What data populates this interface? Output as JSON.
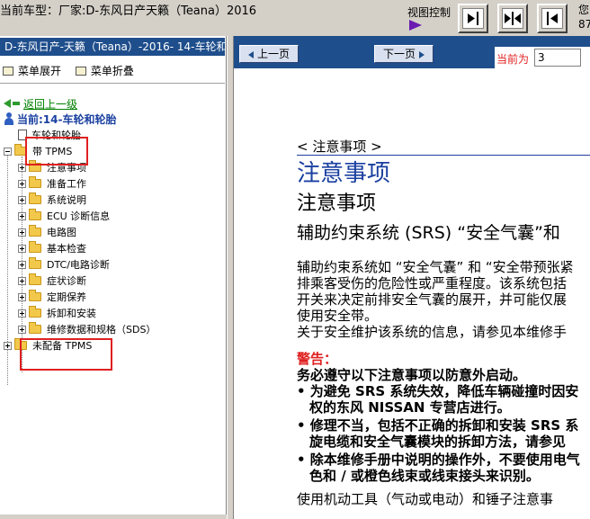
{
  "topbar": {
    "title": "当前车型：厂家:D-东风日产天籁（Teana）2016",
    "view_control_label": "视图控制",
    "right_text": "您 87"
  },
  "left": {
    "header": "D-东风日产-天籁（Teana）-2016- 14-车轮和轮胎",
    "expand_all": "菜单展开",
    "collapse_all": "菜单折叠",
    "back": "返回上一级",
    "current": "当前:14-车轮和轮胎",
    "doc": "车轮和轮胎",
    "with_tpms": "带 TPMS",
    "children": [
      "注意事项",
      "准备工作",
      "系统说明",
      "ECU 诊断信息",
      "电路图",
      "基本检查",
      "DTC/电路诊断",
      "症状诊断",
      "定期保养",
      "拆卸和安装",
      "维修数据和规格（SDS）"
    ],
    "without_tpms": "未配备 TPMS"
  },
  "right": {
    "prev": "上一页",
    "next": "下一页",
    "page_label": "当前为",
    "page_value": "3",
    "crumb": "< 注意事项 >",
    "h1": "注意事项",
    "h2": "注意事项",
    "h3": "辅助约束系统 (SRS) “安全气囊”和",
    "para1": "辅助约束系统如 “安全气囊” 和 “安全带预张紧",
    "para2": "排乘客受伤的危险性或严重程度。该系统包括",
    "para3": "开关来决定前排安全气囊的展开，并可能仅展",
    "para4": "使用安全带。",
    "para5": "关于安全维护该系统的信息，请参见本维修手",
    "warn": "警告：",
    "warn_line": "务必遵守以下注意事项以防意外启动。",
    "b1a": "• 为避免 SRS 系统失效，降低车辆碰撞时因安",
    "b1b": "权的东风 NISSAN 专营店进行。",
    "b2a": "• 修理不当，包括不正确的拆卸和安装 SRS 系",
    "b2b": "旋电缆和安全气囊模块的拆卸方法，请参见",
    "b3a": "• 除本维修手册中说明的操作外，不要使用电气",
    "b3b": "色和 / 或橙色线束或线束接头来识别。",
    "last": "使用机动工具（气动或电动）和锤子注意事"
  },
  "colors": {
    "header_blue": "#1f4e8c",
    "link_green": "#008000",
    "alert_red": "#e02020",
    "heading_blue": "#1a3fa0"
  }
}
